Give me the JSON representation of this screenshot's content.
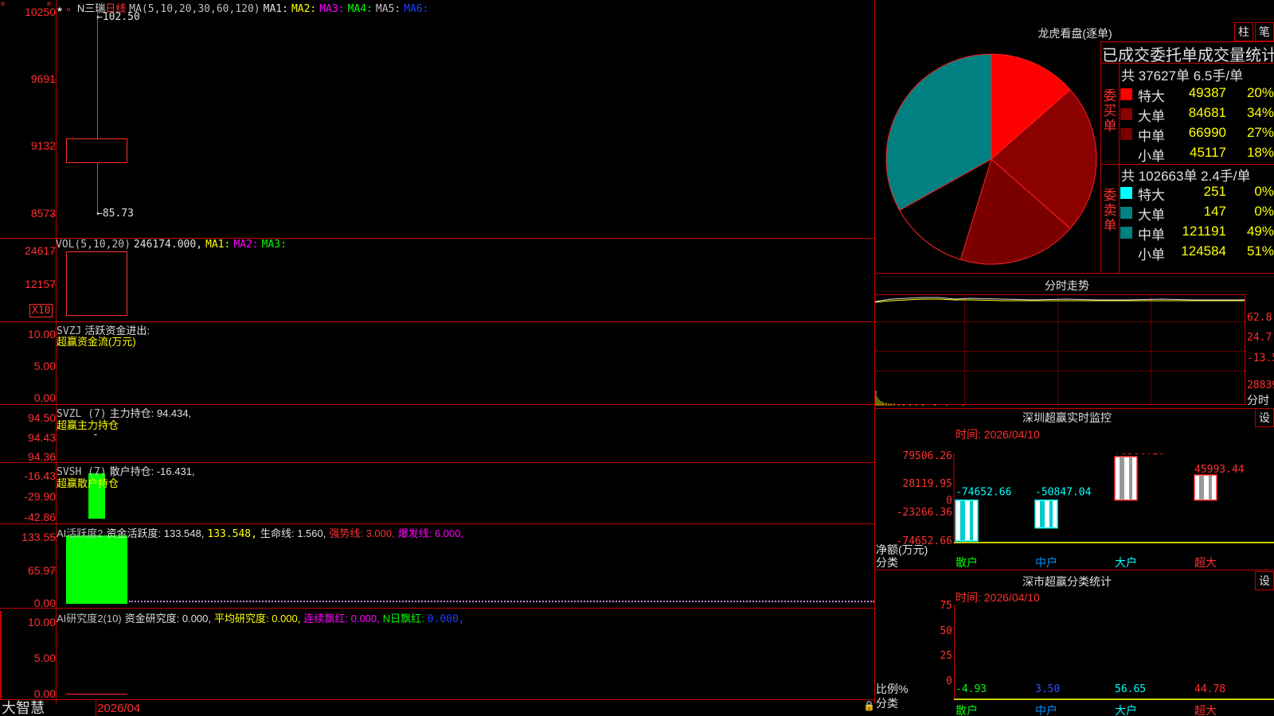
{
  "app": {
    "brand": "大智慧",
    "bottom_date": "2026/04"
  },
  "stock": {
    "star": "★",
    "name": "N三瑞",
    "period": "日线",
    "ma_label": "MA(5,10,20,30,60,120)",
    "ma1": "MA1:",
    "ma2": "MA2:",
    "ma3": "MA3:",
    "ma4": "MA4:",
    "ma5": "MA5:",
    "ma6": "MA6:"
  },
  "price_panel": {
    "axis": [
      "10250",
      "9691",
      "9132",
      "8573"
    ],
    "high_label": "←102.50",
    "low_label": "←85.73"
  },
  "vol_panel": {
    "label": "VOL(5,10,20)",
    "value": "246174.000,",
    "ma1": "MA1:",
    "ma2": "MA2:",
    "ma3": "MA3:",
    "axis": [
      "24617",
      "12157"
    ],
    "unit": "X10"
  },
  "svzj_panel": {
    "label": "SVZJ",
    "title": "活跃资金进出:",
    "sub": "超赢资金流(万元)",
    "axis": [
      "10.00",
      "5.00",
      "0.00"
    ]
  },
  "svzl_panel": {
    "label": "SVZL (7)",
    "title": "主力持仓: 94.434,",
    "sub": "超赢主力持仓",
    "dash": "-",
    "axis": [
      "94.50",
      "94.43",
      "94.36"
    ]
  },
  "svsh_panel": {
    "label": "SVSH (7)",
    "title": "散户持仓: -16.431,",
    "sub": "超赢散户持仓",
    "axis": [
      "-16.43",
      "-29.90",
      "-42.86"
    ]
  },
  "ai_active_panel": {
    "label": "AI活跃度2",
    "t1": "资金活跃度: 133.548,",
    "t2": "133.548,",
    "t3": "生命线: 1.560,",
    "t4": "强势线: 3.000,",
    "t5": "爆发线: 6.000,",
    "axis": [
      "133.55",
      "65.97",
      "0.00"
    ]
  },
  "ai_research_panel": {
    "label": "AI研究度2(10)",
    "t1": "资金研究度: 0.000,",
    "t2": "平均研究度: 0.000,",
    "t3": "连续飘红: 0.000,",
    "t4": "N日飘红:",
    "t5": "0.000,",
    "axis": [
      "10.00",
      "5.00",
      "0.00"
    ]
  },
  "dragon": {
    "title": "龙虎看盘(逐单)",
    "btn_bar": "柱",
    "btn_pen": "笔",
    "stats_title": "已成交委托单成交量统计",
    "buy_label": "委买单",
    "sell_label": "委卖单",
    "buy_summary": "共 37627单 6.5手/单",
    "sell_summary": "共 102663单 2.4手/单",
    "buy_rows": [
      {
        "name": "特大",
        "count": "49387",
        "pct": "20%",
        "color": "#ff0000"
      },
      {
        "name": "大单",
        "count": "84681",
        "pct": "34%",
        "color": "#8b0000"
      },
      {
        "name": "中单",
        "count": "66990",
        "pct": "27%",
        "color": "#7a0000"
      },
      {
        "name": "小单",
        "count": "45117",
        "pct": "18%",
        "color": "#000000"
      }
    ],
    "sell_rows": [
      {
        "name": "特大",
        "count": "251",
        "pct": "0%",
        "color": "#00ffff"
      },
      {
        "name": "大单",
        "count": "147",
        "pct": "0%",
        "color": "#008080"
      },
      {
        "name": "中单",
        "count": "121191",
        "pct": "49%",
        "color": "#008080"
      },
      {
        "name": "小单",
        "count": "124584",
        "pct": "51%",
        "color": "#000000"
      }
    ]
  },
  "intraday": {
    "title": "分时走势",
    "axis": [
      "62.8",
      "24.7",
      "-13.5",
      "28839"
    ],
    "footer": "分时"
  },
  "monitor": {
    "title": "深圳超赢实时监控",
    "btn": "设",
    "time": "时间: 2026/04/10",
    "axis": [
      "79506.26",
      "28119.95",
      "0",
      "-23266.36",
      "-74652.66"
    ],
    "footer1": "净额(万元)",
    "footer2": "分类",
    "categories": [
      "散户",
      "中户",
      "大户",
      "超大"
    ],
    "values": [
      "-74652.66",
      "-50847.04",
      "79506.26",
      "45993.44"
    ]
  },
  "classify": {
    "title": "深市超赢分类统计",
    "btn": "设",
    "time": "时间: 2026/04/10",
    "axis": [
      "75",
      "50",
      "25",
      "0"
    ],
    "footer1": "比例%",
    "footer2": "分类",
    "categories": [
      "散户",
      "中户",
      "大户",
      "超大"
    ],
    "values": [
      "-4.93",
      "3.50",
      "56.65",
      "44.78"
    ]
  },
  "chart_data": {
    "type": "pie",
    "title": "龙虎看盘(逐单)",
    "slices": [
      {
        "name": "特大(买)",
        "value": 20,
        "color": "#ff0000"
      },
      {
        "name": "大单(买)",
        "value": 34,
        "color": "#8b0000"
      },
      {
        "name": "中单(买)",
        "value": 27,
        "color": "#7a0000"
      },
      {
        "name": "小单(买)",
        "value": 18,
        "color": "#000000"
      },
      {
        "name": "中单(卖)",
        "value": 49,
        "color": "#008080"
      }
    ]
  }
}
